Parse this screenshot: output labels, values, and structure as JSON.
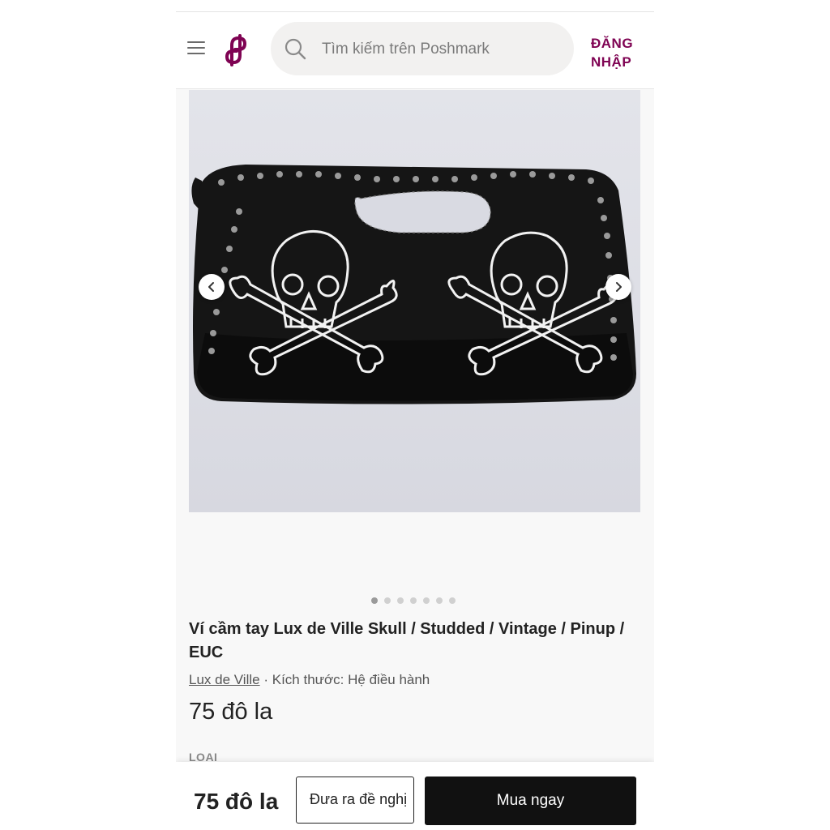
{
  "header": {
    "search_placeholder": "Tìm kiếm trên Poshmark",
    "login_label": "ĐĂNG NHẬP"
  },
  "gallery": {
    "image_count": 7,
    "active_index": 0
  },
  "product": {
    "title": "Ví cầm tay Lux de Ville Skull / Studded / Vintage / Pinup / EUC",
    "brand": "Lux de Ville",
    "separator": "·",
    "size_text": "Kích thước: Hệ điều hành",
    "price": "75 đô la",
    "category_label": "LOẠI"
  },
  "bottom_bar": {
    "price": "75 đô la",
    "offer_label": "Đưa ra đề nghị",
    "buy_label": "Mua ngay"
  },
  "colors": {
    "brand": "#7f0353",
    "button_dark": "#111111"
  }
}
